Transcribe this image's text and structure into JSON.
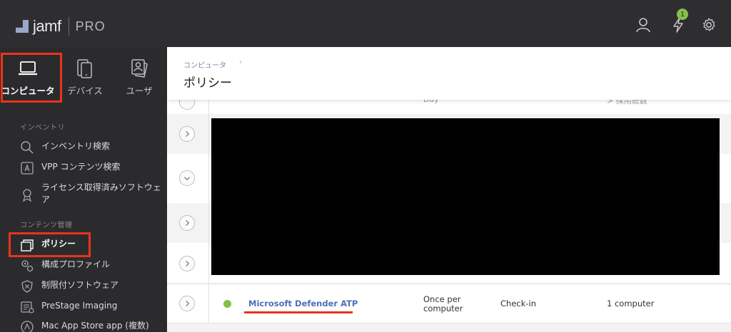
{
  "app": {
    "logo_name": "jamf",
    "logo_product": "PRO",
    "notification_count": "1",
    "icons": [
      "user-icon",
      "bolt-icon",
      "gear-icon"
    ]
  },
  "sidebar": {
    "categories": [
      {
        "label": "コンピュータ",
        "icon": "laptop-icon",
        "active": true
      },
      {
        "label": "デバイス",
        "icon": "devices-icon",
        "active": false
      },
      {
        "label": "ユーザ",
        "icon": "users-icon",
        "active": false
      }
    ],
    "inventory_section": "インベントリ",
    "inventory_items": [
      {
        "label": "インベントリ検索",
        "icon": "search-icon"
      },
      {
        "label": "VPP コンテンツ検索",
        "icon": "app-store-icon"
      },
      {
        "label": "ライセンス取得済みソフトウェア",
        "icon": "license-icon"
      }
    ],
    "content_section": "コンテンツ管理",
    "content_items": [
      {
        "label": "ポリシー",
        "icon": "policy-icon",
        "active": true
      },
      {
        "label": "構成プロファイル",
        "icon": "gears-icon"
      },
      {
        "label": "制限付ソフトウェア",
        "icon": "shield-icon"
      },
      {
        "label": "PreStage Imaging",
        "icon": "imaging-icon"
      },
      {
        "label": "Mac App Store app (複数)",
        "icon": "app-store-icon"
      }
    ]
  },
  "header": {
    "breadcrumb": "コンピュータ",
    "breadcrumb_sep": "›",
    "title": "ポリシー"
  },
  "table": {
    "partial_row": {
      "freq": "Day",
      "scope": "> 採用総数"
    },
    "highlighted_policy": {
      "name": "Microsoft Defender ATP",
      "frequency": "Once per computer",
      "trigger": "Check-in",
      "scope": "1 computer",
      "status_color": "#82c148"
    }
  },
  "colors": {
    "accent_red": "#e8341c",
    "link_blue": "#4b70b8",
    "badge_green": "#84c04a"
  }
}
